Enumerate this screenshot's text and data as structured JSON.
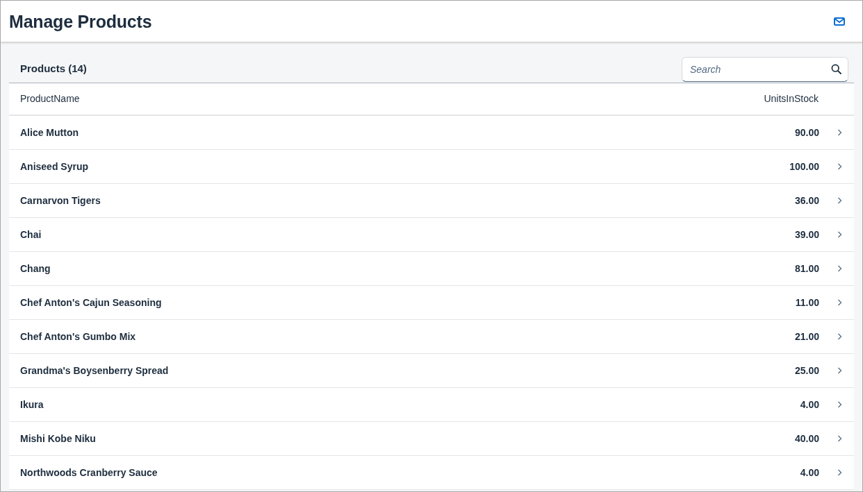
{
  "page": {
    "title": "Manage Products"
  },
  "toolbar": {
    "title": "Products (14)",
    "search": {
      "placeholder": "Search"
    }
  },
  "table": {
    "columns": [
      "ProductName",
      "UnitsInStock"
    ],
    "rows": [
      {
        "product_name": "Alice Mutton",
        "units_in_stock": "90.00"
      },
      {
        "product_name": "Aniseed Syrup",
        "units_in_stock": "100.00"
      },
      {
        "product_name": "Carnarvon Tigers",
        "units_in_stock": "36.00"
      },
      {
        "product_name": "Chai",
        "units_in_stock": "39.00"
      },
      {
        "product_name": "Chang",
        "units_in_stock": "81.00"
      },
      {
        "product_name": "Chef Anton's Cajun Seasoning",
        "units_in_stock": "11.00"
      },
      {
        "product_name": "Chef Anton's Gumbo Mix",
        "units_in_stock": "21.00"
      },
      {
        "product_name": "Grandma's Boysenberry Spread",
        "units_in_stock": "25.00"
      },
      {
        "product_name": "Ikura",
        "units_in_stock": "4.00"
      },
      {
        "product_name": "Mishi Kobe Niku",
        "units_in_stock": "40.00"
      },
      {
        "product_name": "Northwoods Cranberry Sauce",
        "units_in_stock": "4.00"
      }
    ]
  }
}
